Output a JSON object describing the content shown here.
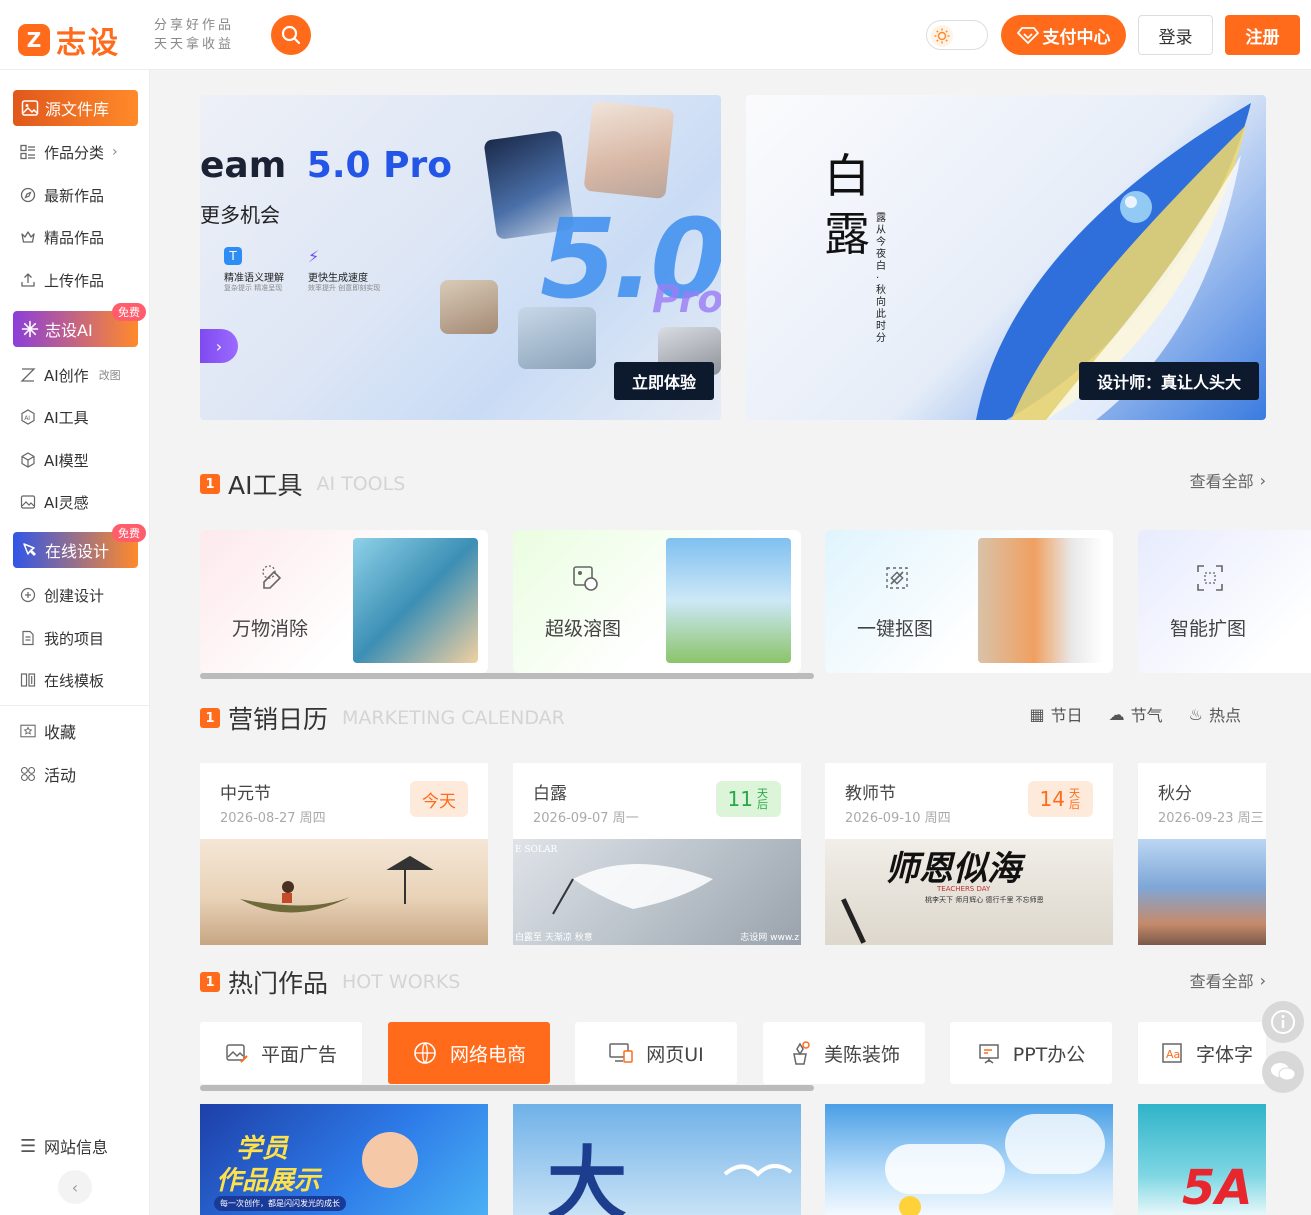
{
  "header": {
    "logo_mark": "Z",
    "logo_text": "志设",
    "slogan_line1": "分享好作品",
    "slogan_line2": "天天拿收益",
    "pay_label": "支付中心",
    "login_label": "登录",
    "register_label": "注册"
  },
  "sidebar": {
    "library": "源文件库",
    "category": "作品分类",
    "latest": "最新作品",
    "featured": "精品作品",
    "upload": "上传作品",
    "ai_head": "志设AI",
    "ai_badge": "免费",
    "ai_create": "AI创作",
    "ai_create_tag": "改图",
    "ai_tools": "AI工具",
    "ai_model": "AI模型",
    "ai_inspire": "AI灵感",
    "design_head": "在线设计",
    "design_badge": "免费",
    "create_design": "创建设计",
    "my_projects": "我的项目",
    "online_templates": "在线模板",
    "favorites": "收藏",
    "activities": "活动",
    "site_info": "网站信息"
  },
  "banners": {
    "b1_title_a": "eam",
    "b1_title_b": "5.0 Pro",
    "b1_subtitle": "更多机会",
    "b1_feature1": "精准语义理解",
    "b1_feature1_sub": "复杂提示 精准呈现",
    "b1_feature2": "更快生成速度",
    "b1_feature2_sub": "效率提升 创意即刻实现",
    "b1_big": "5.0",
    "b1_big_tail": "Pro",
    "b1_cta": "立即体验",
    "b2_char1": "白",
    "b2_char2": "露",
    "b2_verse": "露从今夜白 · 秋向此时分",
    "b2_cta": "设计师：真让人头大"
  },
  "ai_tools": {
    "mark": "1",
    "title": "AI工具",
    "title_en": "AI TOOLS",
    "view_all": "查看全部",
    "items": [
      {
        "name": "万物消除"
      },
      {
        "name": "超级溶图"
      },
      {
        "name": "一键抠图"
      },
      {
        "name": "智能扩图"
      }
    ]
  },
  "calendar": {
    "mark": "1",
    "title": "营销日历",
    "title_en": "MARKETING CALENDAR",
    "filters": [
      "节日",
      "节气",
      "热点"
    ],
    "items": [
      {
        "name": "中元节",
        "date": "2026-08-27 周四",
        "badge": "今天",
        "badge_unit": ""
      },
      {
        "name": "白露",
        "date": "2026-09-07 周一",
        "badge": "11",
        "badge_unit": "天后"
      },
      {
        "name": "教师节",
        "date": "2026-09-10 周四",
        "badge": "14",
        "badge_unit": "天后"
      },
      {
        "name": "秋分",
        "date": "2026-09-23 周三",
        "badge": "",
        "badge_unit": ""
      }
    ],
    "teacher_art": "师恩似海",
    "teacher_sub": "TEACHERS DAY",
    "teacher_caption": "桃李天下  师月辉心  德行千里  不忘师恩",
    "bailu_left": "E SOLAR",
    "bailu_caption": "白露至 天渐凉 秋意",
    "bailu_wm": "志设网 www.z"
  },
  "hot_works": {
    "mark": "1",
    "title": "热门作品",
    "title_en": "HOT WORKS",
    "view_all": "查看全部",
    "tabs": [
      "平面广告",
      "网络电商",
      "网页UI",
      "美陈装饰",
      "PPT办公",
      "字体字"
    ],
    "w1_title1": "学员",
    "w1_title2": "作品展示",
    "w1_sub": "每一次创作，都是闪闪发光的成长",
    "w2_char": "大",
    "w4_text": "5A"
  },
  "colors": {
    "accent": "#ff6b1a",
    "ai_gradient_start": "#8b3fd9",
    "design_gradient_start": "#3056e8",
    "badge": "#ff5c6c"
  }
}
